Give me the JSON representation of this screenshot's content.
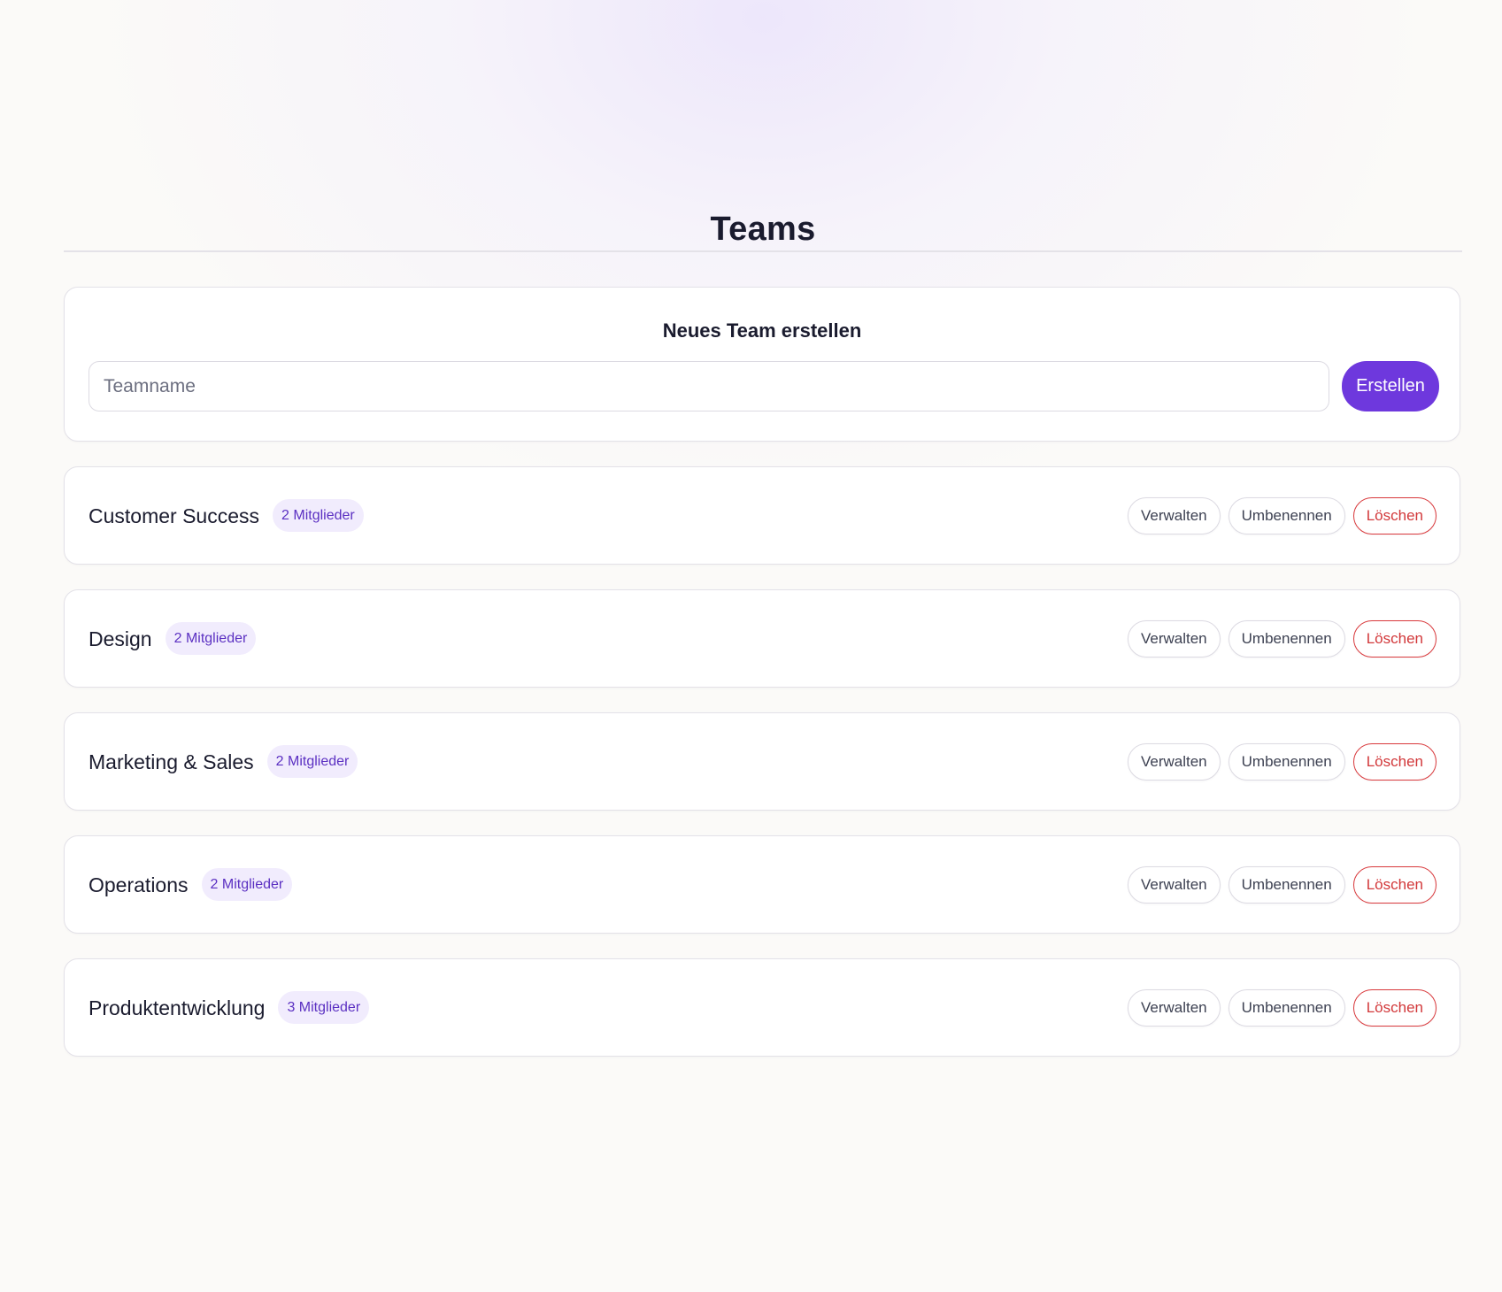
{
  "page": {
    "title": "Teams"
  },
  "create_team": {
    "title": "Neues Team erstellen",
    "input_placeholder": "Teamname",
    "input_value": "",
    "submit_label": "Erstellen"
  },
  "teams": [
    {
      "name": "Customer Success",
      "members_label": "2 Mitglieder"
    },
    {
      "name": "Design",
      "members_label": "2 Mitglieder"
    },
    {
      "name": "Marketing & Sales",
      "members_label": "2 Mitglieder"
    },
    {
      "name": "Operations",
      "members_label": "2 Mitglieder"
    },
    {
      "name": "Produktentwicklung",
      "members_label": "3 Mitglieder"
    }
  ],
  "team_actions": {
    "manage_label": "Verwalten",
    "rename_label": "Umbenennen",
    "delete_label": "Löschen"
  },
  "colors": {
    "accent": "#6e38dd",
    "badge_background": "#f1ecfd",
    "badge_text": "#5b30c2",
    "danger": "#d2383a",
    "page_background": "#fbfaf8"
  }
}
